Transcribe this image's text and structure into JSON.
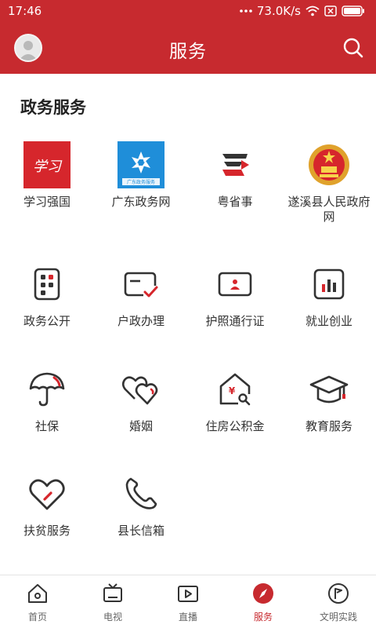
{
  "status_bar": {
    "time": "17:46",
    "speed": "73.0K/s"
  },
  "header": {
    "title": "服务"
  },
  "sections": [
    {
      "title": "政务服务",
      "items": [
        {
          "label": "学习强国",
          "logo_text": "学习"
        },
        {
          "label": "广东政务网",
          "logo_text": "广东政务服务"
        },
        {
          "label": "粤省事"
        },
        {
          "label": "遂溪县人民政府网"
        },
        {
          "label": "政务公开"
        },
        {
          "label": "户政办理"
        },
        {
          "label": "护照通行证"
        },
        {
          "label": "就业创业"
        },
        {
          "label": "社保"
        },
        {
          "label": "婚姻"
        },
        {
          "label": "住房公积金",
          "icon_text": "¥"
        },
        {
          "label": "教育服务"
        },
        {
          "label": "扶贫服务"
        },
        {
          "label": "县长信箱"
        }
      ]
    }
  ],
  "tabbar": [
    {
      "label": "首页",
      "icon": "home-icon"
    },
    {
      "label": "电视",
      "icon": "tv-icon"
    },
    {
      "label": "直播",
      "icon": "live-icon"
    },
    {
      "label": "服务",
      "icon": "compass-icon",
      "active": true
    },
    {
      "label": "文明实践",
      "icon": "flag-icon"
    }
  ],
  "colors": {
    "brand": "#c72a2f",
    "icon_stroke": "#333333"
  }
}
